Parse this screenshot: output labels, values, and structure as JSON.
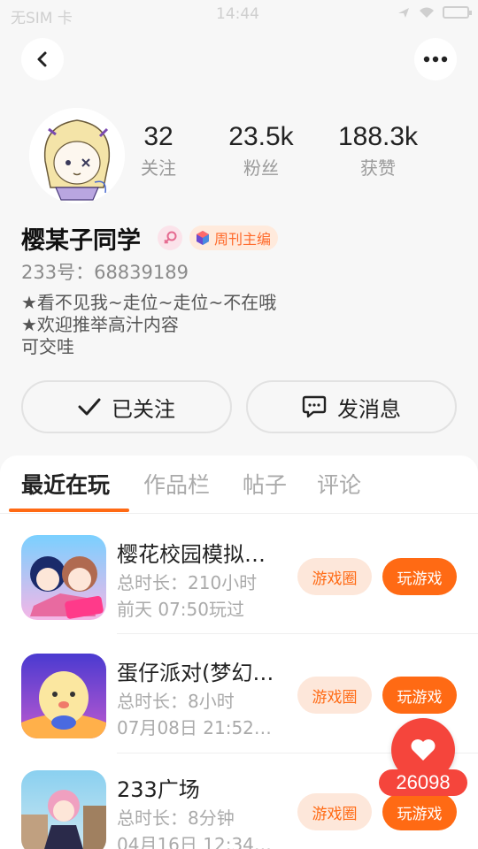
{
  "status_bar": {
    "carrier": "无SIM 卡",
    "time": "14:44"
  },
  "profile": {
    "name": "樱某子同学",
    "badge": "周刊主编",
    "uid": "233号：68839189",
    "bio": [
      "★看不见我~走位~走位~不在哦",
      "★欢迎推举高汁内容",
      "可交哇"
    ],
    "stats": [
      {
        "value": "32",
        "label": "关注"
      },
      {
        "value": "23.5k",
        "label": "粉丝"
      },
      {
        "value": "188.3k",
        "label": "获赞"
      }
    ]
  },
  "actions": {
    "follow": "已关注",
    "message": "发消息"
  },
  "tabs": [
    "最近在玩",
    "作品栏",
    "帖子",
    "评论"
  ],
  "games": [
    {
      "title": "樱花校园模拟…",
      "duration": "总时长：210小时",
      "last_played": "前天 07:50玩过",
      "circle_label": "游戏圈",
      "play_label": "玩游戏"
    },
    {
      "title": "蛋仔派对(梦幻…",
      "duration": "总时长：8小时",
      "last_played": "07月08日 21:52…",
      "circle_label": "游戏圈",
      "play_label": "玩游戏"
    },
    {
      "title": "233广场",
      "duration": "总时长：8分钟",
      "last_played": "04月16日 12:34…",
      "circle_label": "游戏圈",
      "play_label": "玩游戏"
    }
  ],
  "favorite": {
    "count": "26098"
  },
  "colors": {
    "accent": "#ff6a14",
    "favorite": "#f5453c",
    "badge_bg": "#ffeadc"
  }
}
